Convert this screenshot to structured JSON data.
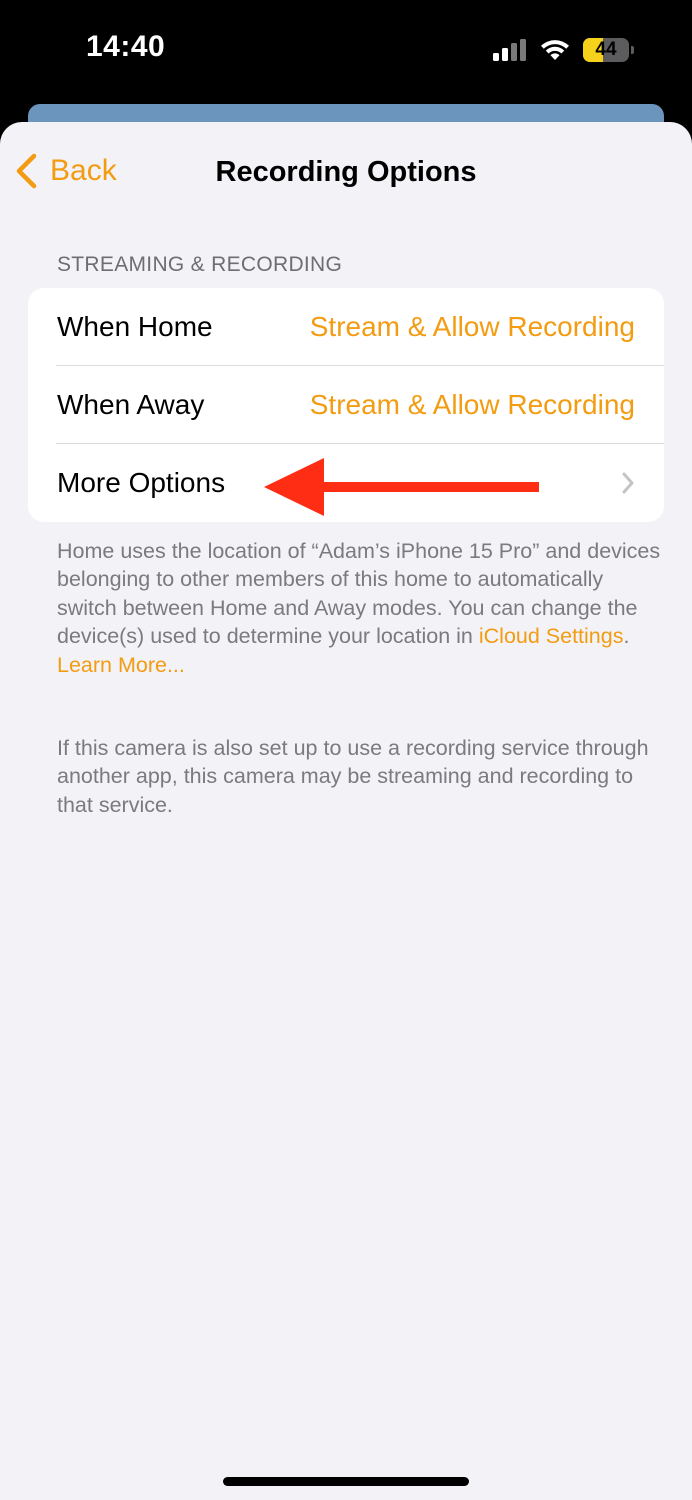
{
  "status_bar": {
    "time": "14:40",
    "battery_level": "44",
    "battery_color": "#f7d21a",
    "icons": [
      "signal-icon",
      "wifi-icon",
      "battery-icon"
    ]
  },
  "nav": {
    "back_label": "Back",
    "title": "Recording Options",
    "back_icon": "chevron-left-icon"
  },
  "section": {
    "header": "STREAMING & RECORDING",
    "rows": [
      {
        "label": "When Home",
        "value": "Stream & Allow Recording"
      },
      {
        "label": "When Away",
        "value": "Stream & Allow Recording"
      },
      {
        "label": "More Options",
        "value": ""
      }
    ]
  },
  "annotation": {
    "icon": "red-arrow-left-icon",
    "color": "#ff2d14"
  },
  "footer": {
    "location_text": "Home uses the location of “Adam’s iPhone 15 Pro” and devices belonging to other members of this home to automatically switch between Home and Away modes. You can change the device(s) used to determine your location in ",
    "icloud_link": "iCloud Settings",
    "period": ".",
    "learn_more": "Learn More...",
    "service_text": "If this camera is also set up to use a recording service through another app, this camera may be streaming and recording to that service."
  },
  "colors": {
    "accent": "#f39c12",
    "background": "#f2f2f7",
    "secondary_text": "#7a7a7f"
  }
}
